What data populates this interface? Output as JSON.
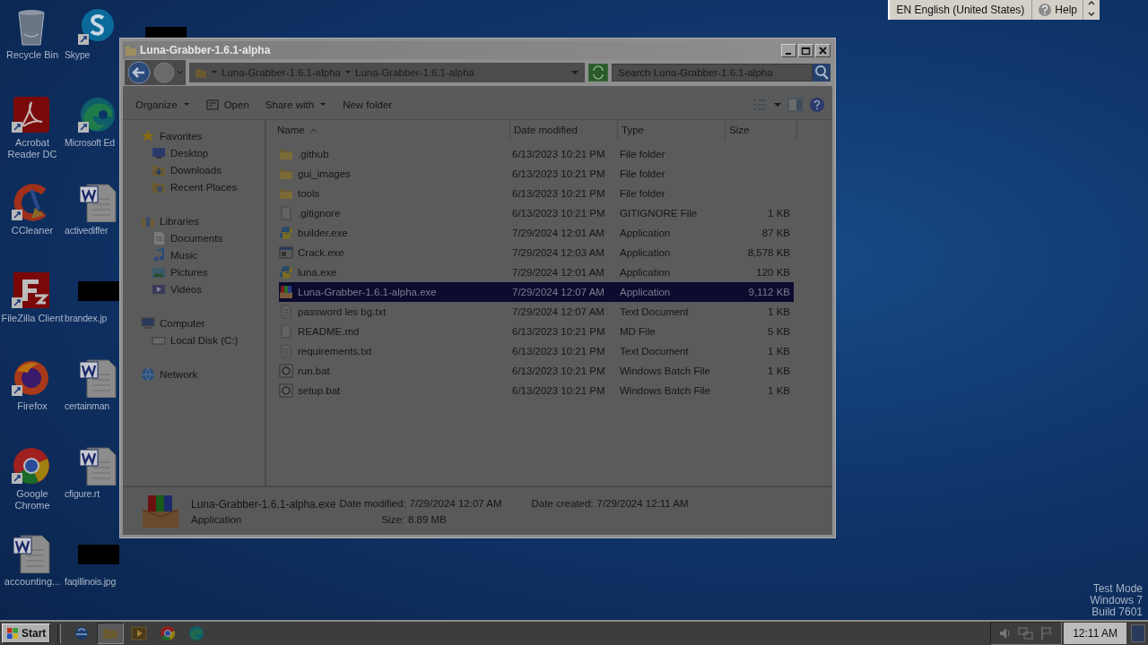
{
  "language_bar": {
    "language": "EN English (United States)",
    "help": "Help"
  },
  "desktop_icons": [
    {
      "label": "Recycle Bin",
      "kind": "recycle",
      "shortcut": false
    },
    {
      "label": "Skype",
      "kind": "skype",
      "shortcut": true
    },
    {
      "label": "Acrobat Reader DC",
      "kind": "acrobat",
      "shortcut": true
    },
    {
      "label": "Microsoft Ed",
      "kind": "edge",
      "shortcut": true
    },
    {
      "label": "CCleaner",
      "kind": "ccleaner",
      "shortcut": true
    },
    {
      "label": "activediffer",
      "kind": "word",
      "shortcut": false
    },
    {
      "label": "FileZilla Client",
      "kind": "filezilla",
      "shortcut": true
    },
    {
      "label": "brandex.jp",
      "kind": "thumbnail",
      "shortcut": false
    },
    {
      "label": "Firefox",
      "kind": "firefox",
      "shortcut": true
    },
    {
      "label": "certainman",
      "kind": "word",
      "shortcut": false
    },
    {
      "label": "Google Chrome",
      "kind": "chrome",
      "shortcut": true
    },
    {
      "label": "cfigure.rt",
      "kind": "word",
      "shortcut": false
    },
    {
      "label": "accounting...",
      "kind": "word",
      "shortcut": false
    },
    {
      "label": "faqillinois.jpg",
      "kind": "thumbnail",
      "shortcut": false
    }
  ],
  "window": {
    "title": "Luna-Grabber-1.6.1-alpha",
    "breadcrumbs": [
      "Luna-Grabber-1.6.1-alpha",
      "Luna-Grabber-1.6.1-alpha"
    ],
    "search": {
      "placeholder": "Search Luna-Grabber-1.6.1-alpha"
    },
    "toolbar": [
      {
        "label": "Organize",
        "kind": "menu"
      },
      {
        "label": "Open",
        "kind": "open"
      },
      {
        "label": "Share with",
        "kind": "menu"
      },
      {
        "label": "New folder",
        "kind": "plain"
      }
    ],
    "nav": [
      {
        "label": "Favorites",
        "kind": "favorites",
        "children": [
          {
            "label": "Desktop",
            "kind": "desktop"
          },
          {
            "label": "Downloads",
            "kind": "downloads"
          },
          {
            "label": "Recent Places",
            "kind": "recent"
          }
        ]
      },
      {
        "label": "Libraries",
        "kind": "libraries",
        "children": [
          {
            "label": "Documents",
            "kind": "documents"
          },
          {
            "label": "Music",
            "kind": "music"
          },
          {
            "label": "Pictures",
            "kind": "pictures"
          },
          {
            "label": "Videos",
            "kind": "videos"
          }
        ]
      },
      {
        "label": "Computer",
        "kind": "computer",
        "children": [
          {
            "label": "Local Disk (C:)",
            "kind": "disk"
          }
        ]
      },
      {
        "label": "Network",
        "kind": "network"
      }
    ],
    "columns": [
      {
        "label": "Name",
        "sorted": true
      },
      {
        "label": "Date modified",
        "sorted": false
      },
      {
        "label": "Type",
        "sorted": false
      },
      {
        "label": "Size",
        "sorted": false
      }
    ],
    "rows": [
      {
        "name": ".github",
        "date": "6/13/2023 10:21 PM",
        "type": "File folder",
        "kind": "folder",
        "selected": false
      },
      {
        "name": "gui_images",
        "date": "6/13/2023 10:21 PM",
        "type": "File folder",
        "kind": "folder",
        "selected": false
      },
      {
        "name": "tools",
        "date": "6/13/2023 10:21 PM",
        "type": "File folder",
        "kind": "folder",
        "selected": false
      },
      {
        "name": ".gitignore",
        "date": "6/13/2023 10:21 PM",
        "type": "GITIGNORE File",
        "size": "1 KB",
        "kind": "file",
        "selected": false
      },
      {
        "name": "builder.exe",
        "date": "7/29/2024 12:01 AM",
        "type": "Application",
        "size": "87 KB",
        "kind": "python",
        "selected": false
      },
      {
        "name": "Crack.exe",
        "date": "7/29/2024 12:03 AM",
        "type": "Application",
        "size": "8,578 KB",
        "kind": "app",
        "selected": false
      },
      {
        "name": "luna.exe",
        "date": "7/29/2024 12:01 AM",
        "type": "Application",
        "size": "120 KB",
        "kind": "python",
        "selected": false
      },
      {
        "name": "Luna-Grabber-1.6.1-alpha.exe",
        "date": "7/29/2024 12:07 AM",
        "type": "Application",
        "size": "9,112 KB",
        "kind": "archive",
        "selected": true
      },
      {
        "name": "password les bg.txt",
        "date": "7/29/2024 12:07 AM",
        "type": "Text Document",
        "size": "1 KB",
        "kind": "text",
        "selected": false
      },
      {
        "name": "README.md",
        "date": "6/13/2023 10:21 PM",
        "type": "MD File",
        "size": "5 KB",
        "kind": "file",
        "selected": false
      },
      {
        "name": "requirements.txt",
        "date": "6/13/2023 10:21 PM",
        "type": "Text Document",
        "size": "1 KB",
        "kind": "text",
        "selected": false
      },
      {
        "name": "run.bat",
        "date": "6/13/2023 10:21 PM",
        "type": "Windows Batch File",
        "size": "1 KB",
        "kind": "batch",
        "selected": false
      },
      {
        "name": "setup.bat",
        "date": "6/13/2023 10:21 PM",
        "type": "Windows Batch File",
        "size": "1 KB",
        "kind": "batch",
        "selected": false
      }
    ],
    "details": {
      "name": "Luna-Grabber-1.6.1-alpha.exe",
      "type": "Application",
      "modified_label": "Date modified:",
      "modified": "7/29/2024 12:07 AM",
      "size_label": "Size:",
      "size": "8.89 MB",
      "created_label": "Date created:",
      "created": "7/29/2024 12:11 AM"
    }
  },
  "taskbar": {
    "start": "Start",
    "apps": [
      {
        "kind": "ie",
        "selected": false
      },
      {
        "kind": "explorer",
        "selected": true
      },
      {
        "kind": "media",
        "selected": false
      },
      {
        "kind": "chrome",
        "selected": false
      },
      {
        "kind": "edge",
        "selected": false
      }
    ],
    "clock": "12:11 AM"
  },
  "watermark": [
    "Test Mode",
    "Windows 7",
    "Build 7601"
  ]
}
